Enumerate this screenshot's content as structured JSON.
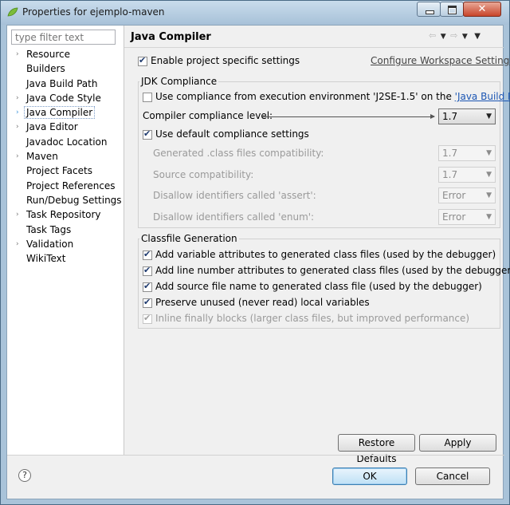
{
  "window": {
    "title": "Properties for ejemplo-maven",
    "close_glyph": "✕"
  },
  "filter": {
    "placeholder": "type filter text"
  },
  "tree": [
    {
      "label": "Resource",
      "arrow": "›"
    },
    {
      "label": "Builders",
      "arrow": ""
    },
    {
      "label": "Java Build Path",
      "arrow": ""
    },
    {
      "label": "Java Code Style",
      "arrow": "›"
    },
    {
      "label": "Java Compiler",
      "arrow": "›",
      "selected": true
    },
    {
      "label": "Java Editor",
      "arrow": "›"
    },
    {
      "label": "Javadoc Location",
      "arrow": ""
    },
    {
      "label": "Maven",
      "arrow": "›"
    },
    {
      "label": "Project Facets",
      "arrow": ""
    },
    {
      "label": "Project References",
      "arrow": ""
    },
    {
      "label": "Run/Debug Settings",
      "arrow": ""
    },
    {
      "label": "Task Repository",
      "arrow": "›"
    },
    {
      "label": "Task Tags",
      "arrow": ""
    },
    {
      "label": "Validation",
      "arrow": "›"
    },
    {
      "label": "WikiText",
      "arrow": ""
    }
  ],
  "page": {
    "title": "Java Compiler",
    "enable_label": "Enable project specific settings",
    "configure_link": "Configure Workspace Settings...",
    "jdk": {
      "group_title": "JDK Compliance",
      "use_env_label": "Use compliance from execution environment 'J2SE-1.5' on the ",
      "use_env_link": "'Java Build Path'",
      "level_label": "Compiler compliance level:",
      "level_value": "1.7",
      "use_default_label": "Use default compliance settings",
      "rows": [
        {
          "label": "Generated .class files compatibility:",
          "value": "1.7"
        },
        {
          "label": "Source compatibility:",
          "value": "1.7"
        },
        {
          "label": "Disallow identifiers called 'assert':",
          "value": "Error"
        },
        {
          "label": "Disallow identifiers called 'enum':",
          "value": "Error"
        }
      ]
    },
    "classfile": {
      "group_title": "Classfile Generation",
      "items": [
        {
          "label": "Add variable attributes to generated class files (used by the debugger)",
          "checked": true,
          "disabled": false
        },
        {
          "label": "Add line number attributes to generated class files (used by the debugger)",
          "checked": true,
          "disabled": false
        },
        {
          "label": "Add source file name to generated class file (used by the debugger)",
          "checked": true,
          "disabled": false
        },
        {
          "label": "Preserve unused (never read) local variables",
          "checked": true,
          "disabled": false
        },
        {
          "label": "Inline finally blocks (larger class files, but improved performance)",
          "checked": true,
          "disabled": true
        }
      ]
    },
    "restore_label": "Restore Defaults",
    "apply_label": "Apply"
  },
  "footer": {
    "help_glyph": "?",
    "ok_label": "OK",
    "cancel_label": "Cancel"
  },
  "icons": {
    "nav_back": "⇦",
    "nav_forward": "⇨",
    "dropdown": "▼"
  }
}
